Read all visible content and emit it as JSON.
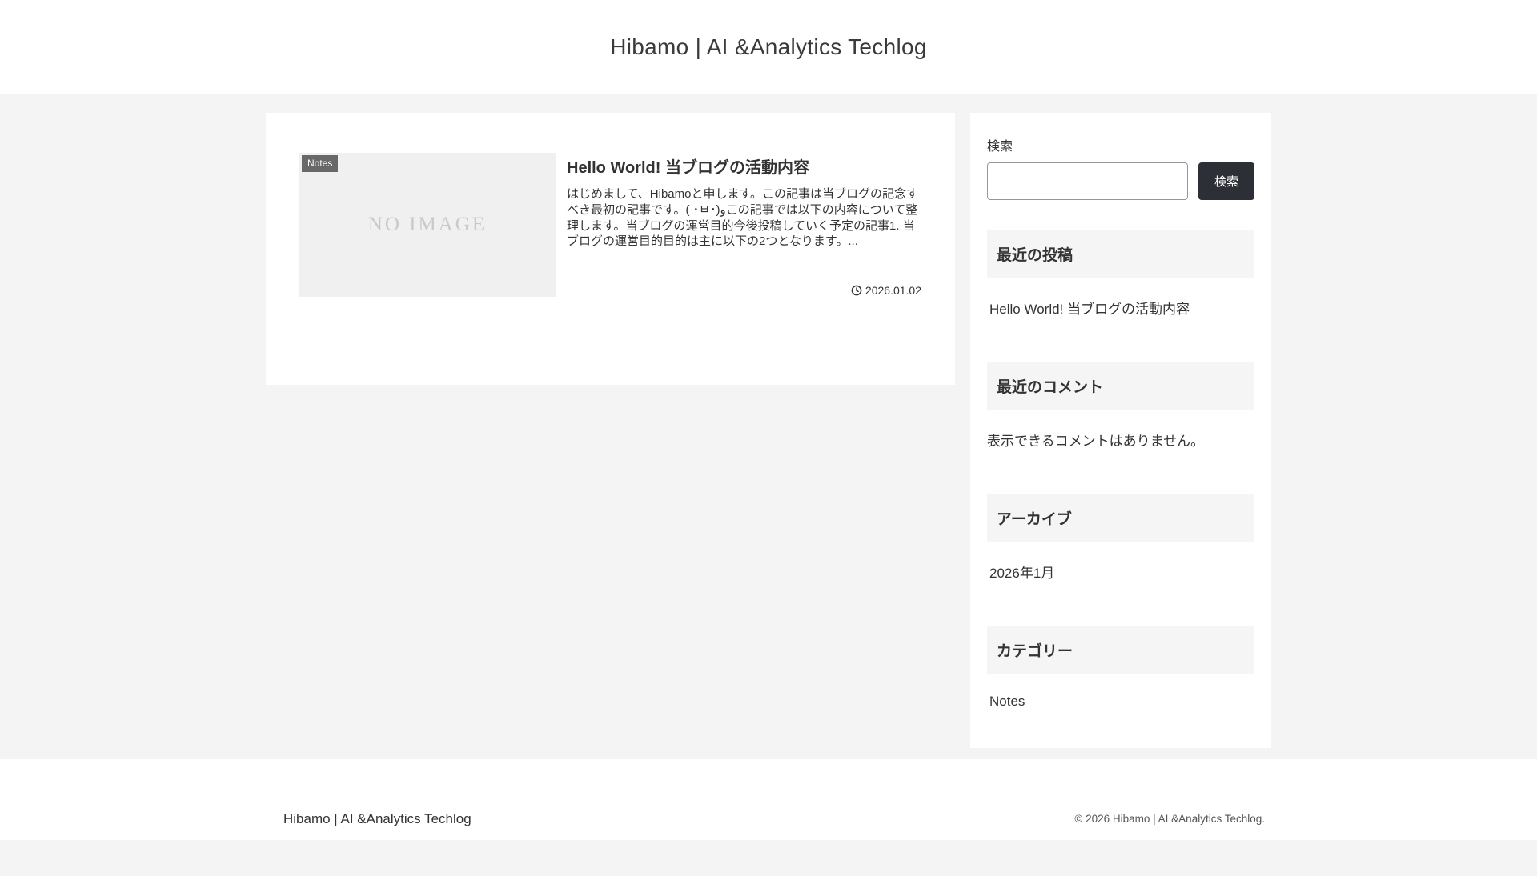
{
  "header": {
    "site_title": "Hibamo | AI &Analytics Techlog"
  },
  "post": {
    "category": "Notes",
    "no_image_label": "NO IMAGE",
    "title": "Hello World! 当ブログの活動内容",
    "excerpt": "はじめまして、Hibamoと申します。この記事は当ブログの記念すべき最初の記事です。( ･ㅂ･)وこの記事では以下の内容について整理します。当ブログの運営目的今後投稿していく予定の記事1. 当ブログの運営目的目的は主に以下の2つとなります。...",
    "date": "2026.01.02"
  },
  "sidebar": {
    "search": {
      "label": "検索",
      "button_label": "検索",
      "input_value": ""
    },
    "widgets": {
      "recent_posts": {
        "title": "最近の投稿",
        "items": [
          "Hello World! 当ブログの活動内容"
        ]
      },
      "recent_comments": {
        "title": "最近のコメント",
        "empty_text": "表示できるコメントはありません。"
      },
      "archives": {
        "title": "アーカイブ",
        "items": [
          "2026年1月"
        ]
      },
      "categories": {
        "title": "カテゴリー",
        "items": [
          "Notes"
        ]
      }
    }
  },
  "footer": {
    "site_title": "Hibamo | AI &Analytics Techlog",
    "copyright": "© 2026 Hibamo | AI &Analytics Techlog."
  },
  "colors": {
    "page_background": "#f4f4f5",
    "card_background": "#ffffff",
    "badge_background": "#686868",
    "search_button_background": "#2c3036",
    "widget_title_background": "#f5f5f6",
    "text": "#333333",
    "no_image_text": "#c9c9c9"
  }
}
